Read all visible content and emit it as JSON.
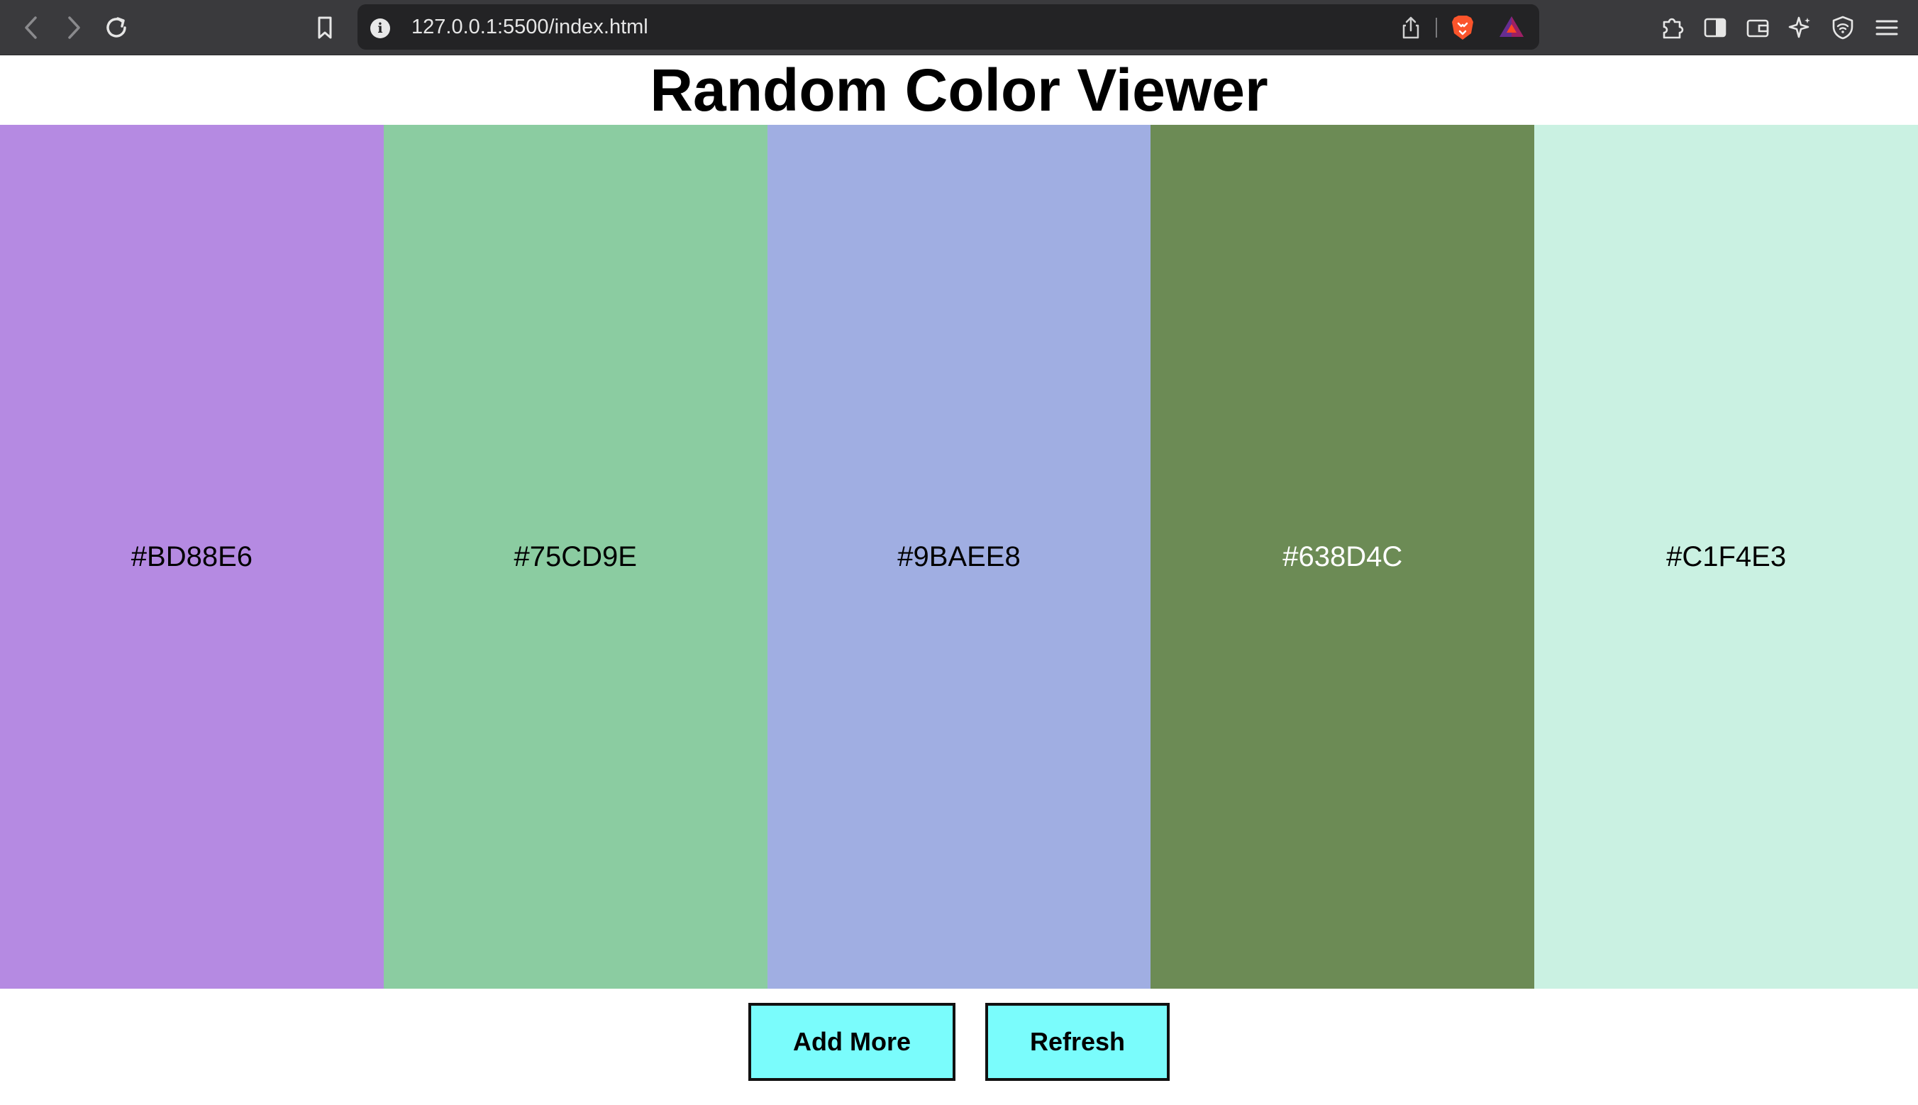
{
  "browser": {
    "url": "127.0.0.1:5500/index.html",
    "icons": {
      "back": "back-arrow-icon",
      "forward": "forward-arrow-icon",
      "reload": "reload-icon",
      "bookmark": "bookmark-icon",
      "site_info": "info-icon",
      "share": "share-icon",
      "brave_shields": "brave-lion-icon",
      "rewards": "bat-triangle-icon",
      "extensions": "puzzle-icon",
      "sidebar": "sidebar-icon",
      "wallet": "wallet-icon",
      "leo": "sparkle-icon",
      "vpn": "vpn-shield-icon",
      "menu": "hamburger-menu-icon"
    },
    "colors": {
      "toolbar": "#3a3a3d",
      "urlbar": "#232325"
    }
  },
  "page": {
    "title": "Random Color Viewer",
    "swatches": [
      {
        "hex": "#BD88E6",
        "label": "#BD88E6",
        "text_color": "#000000",
        "fill": "#b58ae2"
      },
      {
        "hex": "#75CD9E",
        "label": "#75CD9E",
        "text_color": "#000000",
        "fill": "#8bcca1"
      },
      {
        "hex": "#9BAEE8",
        "label": "#9BAEE8",
        "text_color": "#000000",
        "fill": "#a0aee2"
      },
      {
        "hex": "#638D4C",
        "label": "#638D4C",
        "text_color": "#ffffff",
        "fill": "#6c8b55"
      },
      {
        "hex": "#C1F4E3",
        "label": "#C1F4E3",
        "text_color": "#000000",
        "fill": "#caf1e2"
      }
    ],
    "buttons": {
      "add_more": "Add More",
      "refresh": "Refresh"
    },
    "colors": {
      "button_bg": "#7afcfc",
      "button_border": "#111111"
    }
  }
}
